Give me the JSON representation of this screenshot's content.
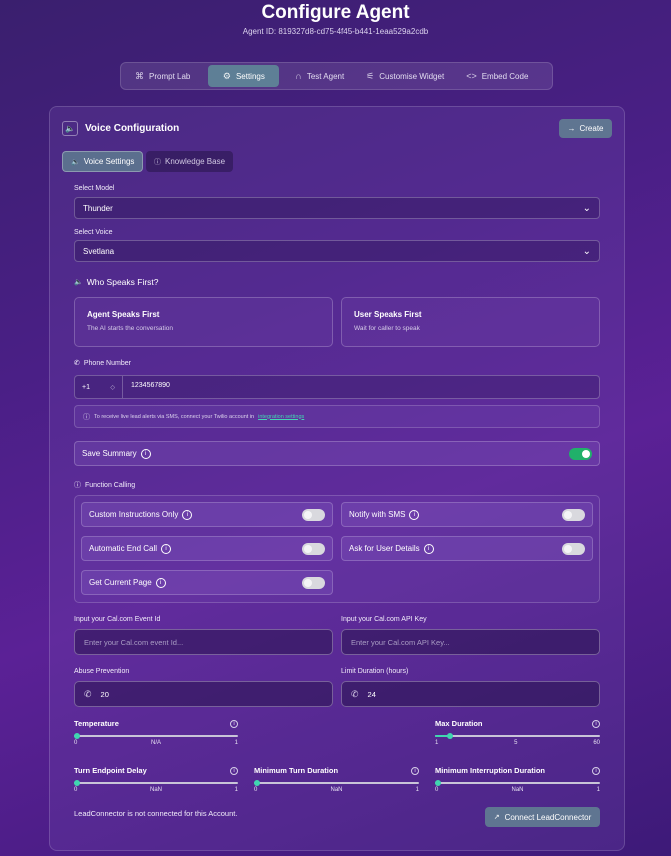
{
  "page": {
    "title": "Configure Agent",
    "agent_id": "Agent ID: 819327d8-cd75-4f45-b441-1eaa529a2cdb"
  },
  "tabs": [
    {
      "label": "Prompt Lab",
      "icon": "command-icon"
    },
    {
      "label": "Settings",
      "icon": "gear-icon",
      "active": true
    },
    {
      "label": "Test Agent",
      "icon": "headphones-icon"
    },
    {
      "label": "Customise Widget",
      "icon": "sliders-icon"
    },
    {
      "label": "Embed Code",
      "icon": "code-icon"
    }
  ],
  "panel": {
    "title": "Voice Configuration",
    "create_label": "Create",
    "subtabs": [
      "Voice Settings",
      "Knowledge Base"
    ]
  },
  "model": {
    "label": "Select Model",
    "value": "Thunder"
  },
  "voice": {
    "label": "Select Voice",
    "value": "Svetlana"
  },
  "who_speaks": {
    "label": "Who Speaks First?",
    "options": [
      {
        "title": "Agent Speaks First",
        "subtitle": "The AI starts the conversation"
      },
      {
        "title": "User Speaks First",
        "subtitle": "Wait for caller to speak"
      }
    ]
  },
  "phone": {
    "label": "Phone Number",
    "country_code": "+1",
    "value": "1234567890",
    "info_text": "To receive live lead alerts via SMS, connect your Twilio account in",
    "info_link": "integration settings"
  },
  "save_summary": {
    "label": "Save Summary",
    "enabled": true
  },
  "function_calling": {
    "label": "Function Calling",
    "items": [
      {
        "label": "Custom Instructions Only",
        "enabled": false
      },
      {
        "label": "Notify with SMS",
        "enabled": false
      },
      {
        "label": "Automatic End Call",
        "enabled": false
      },
      {
        "label": "Ask for User Details",
        "enabled": false
      },
      {
        "label": "Get Current Page",
        "enabled": false
      }
    ]
  },
  "calcom": {
    "event_label": "Input your Cal.com Event Id",
    "event_placeholder": "Enter your Cal.com event Id...",
    "api_label": "Input your Cal.com API Key",
    "api_placeholder": "Enter your Cal.com API Key..."
  },
  "abuse": {
    "label": "Abuse Prevention",
    "value": "20"
  },
  "limit": {
    "label": "Limit Duration (hours)",
    "value": "24"
  },
  "sliders": {
    "temperature": {
      "label": "Temperature",
      "min": "0",
      "mid": "N/A",
      "max": "1",
      "fraction": 0
    },
    "max_duration": {
      "label": "Max Duration",
      "min": "1",
      "mid": "5",
      "max": "60",
      "fraction": 0.085
    },
    "turn_endpoint": {
      "label": "Turn Endpoint Delay",
      "min": "0",
      "mid": "NaN",
      "max": "1",
      "fraction": 0
    },
    "min_turn": {
      "label": "Minimum Turn Duration",
      "min": "0",
      "mid": "NaN",
      "max": "1",
      "fraction": 0
    },
    "min_interrupt": {
      "label": "Minimum Interruption Duration",
      "min": "0",
      "mid": "NaN",
      "max": "1",
      "fraction": 0
    }
  },
  "leadconnector": {
    "status": "LeadConnector is not connected for this Account.",
    "button_label": "Connect LeadConnector"
  },
  "colors": {
    "accent": "#40d6b0",
    "toggle_on": "#21b06a",
    "button": "#5f7591"
  }
}
